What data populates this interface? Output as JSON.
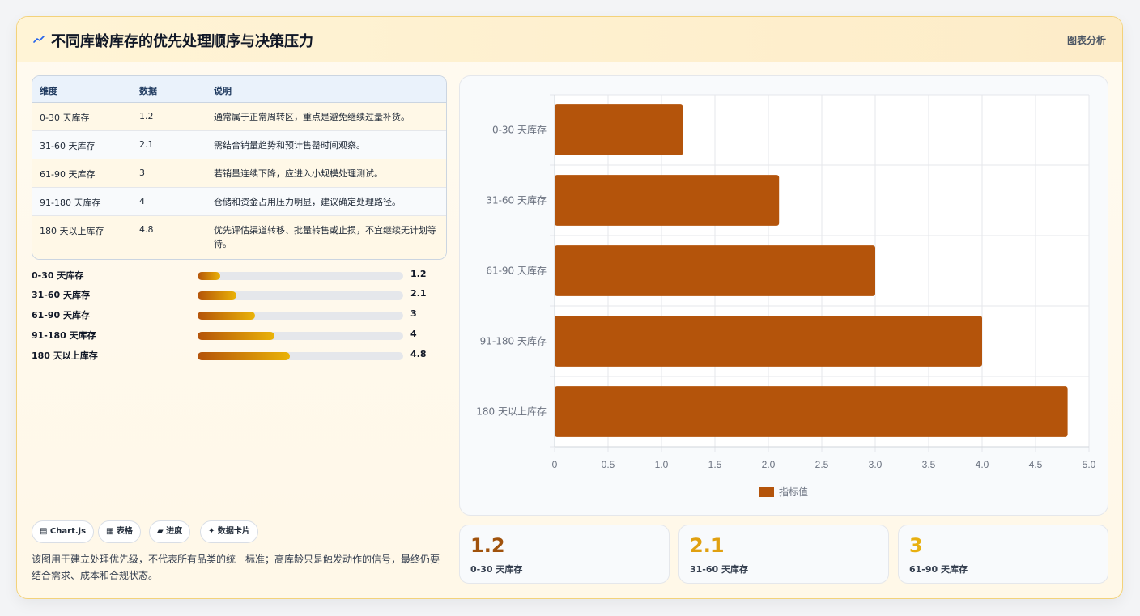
{
  "header": {
    "title": "不同库龄库存的优先处理顺序与决策压力",
    "link": "图表分析"
  },
  "table": {
    "headers": [
      "维度",
      "数据",
      "说明"
    ],
    "rows": [
      {
        "dim": "0-30 天库存",
        "val": "1.2",
        "desc": "通常属于正常周转区，重点是避免继续过量补货。"
      },
      {
        "dim": "31-60 天库存",
        "val": "2.1",
        "desc": "需结合销量趋势和预计售罄时间观察。"
      },
      {
        "dim": "61-90 天库存",
        "val": "3",
        "desc": "若销量连续下降，应进入小规模处理测试。"
      },
      {
        "dim": "91-180 天库存",
        "val": "4",
        "desc": "仓储和资金占用压力明显，建议确定处理路径。"
      },
      {
        "dim": "180 天以上库存",
        "val": "4.8",
        "desc": "优先评估渠道转移、批量转售或止损，不宜继续无计划等待。"
      }
    ]
  },
  "progress": {
    "items": [
      {
        "label": "0-30 天库存",
        "value": "1.2",
        "fraction": 0.11
      },
      {
        "label": "31-60 天库存",
        "value": "2.1",
        "fraction": 0.19
      },
      {
        "label": "61-90 天库存",
        "value": "3",
        "fraction": 0.28
      },
      {
        "label": "91-180 天库存",
        "value": "4",
        "fraction": 0.375
      },
      {
        "label": "180 天以上库存",
        "value": "4.8",
        "fraction": 0.45
      }
    ]
  },
  "tags": [
    "▤ Chart.js",
    "▦ 表格",
    "▰ 进度",
    "✦ 数据卡片"
  ],
  "note": "该图用于建立处理优先级，不代表所有品类的统一标准；高库龄只是触发动作的信号，最终仍要结合需求、成本和合规状态。",
  "kpis": [
    {
      "value": "1.2",
      "label": "0-30 天库存",
      "color": "#a0520c"
    },
    {
      "value": "2.1",
      "label": "31-60 天库存",
      "color": "#e0a010"
    },
    {
      "value": "3",
      "label": "61-90 天库存",
      "color": "#e8b010"
    }
  ],
  "colors": {
    "bar": "#b4540b",
    "accent": "#eab308"
  },
  "icons": {
    "title": "chart-line-icon"
  },
  "chart_data": {
    "type": "bar",
    "orientation": "horizontal",
    "categories": [
      "0-30 天库存",
      "31-60 天库存",
      "61-90 天库存",
      "91-180 天库存",
      "180 天以上库存"
    ],
    "series": [
      {
        "name": "指标值",
        "values": [
          1.2,
          2.1,
          3,
          4,
          4.8
        ]
      }
    ],
    "xlim": [
      0,
      5
    ],
    "xticks": [
      "0",
      "0.5",
      "1.0",
      "1.5",
      "2.0",
      "2.5",
      "3.0",
      "3.5",
      "4.0",
      "4.5",
      "5.0"
    ],
    "grid": true,
    "legend": "bottom"
  }
}
